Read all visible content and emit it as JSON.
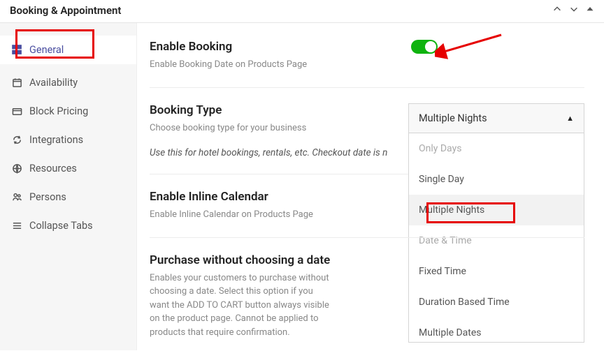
{
  "header": {
    "title": "Booking & Appointment"
  },
  "sidebar": {
    "items": [
      {
        "label": "General"
      },
      {
        "label": "Availability"
      },
      {
        "label": "Block Pricing"
      },
      {
        "label": "Integrations"
      },
      {
        "label": "Resources"
      },
      {
        "label": "Persons"
      },
      {
        "label": "Collapse Tabs"
      }
    ]
  },
  "settings": {
    "enable_booking": {
      "title": "Enable Booking",
      "desc": "Enable Booking Date on Products Page",
      "value": true
    },
    "booking_type": {
      "title": "Booking Type",
      "desc": "Choose booking type for your business",
      "hint": "Use this for hotel bookings, rentals, etc. Checkout date is n",
      "selected": "Multiple Nights",
      "options": [
        "Only Days",
        "Single Day",
        "Multiple Nights",
        "Date & Time",
        "Fixed Time",
        "Duration Based Time",
        "Multiple Dates"
      ]
    },
    "inline_calendar": {
      "title": "Enable Inline Calendar",
      "desc": "Enable Inline Calendar on Products Page"
    },
    "purchase_without_date": {
      "title": "Purchase without choosing a date",
      "desc": "Enables your customers to purchase without choosing a date. Select this option if you want the ADD TO CART button always visible on the product page. Cannot be applied to products that require confirmation."
    }
  },
  "colors": {
    "annotation": "#e60000",
    "toggle_on": "#0fb30f",
    "accent": "#4a4ea0"
  }
}
